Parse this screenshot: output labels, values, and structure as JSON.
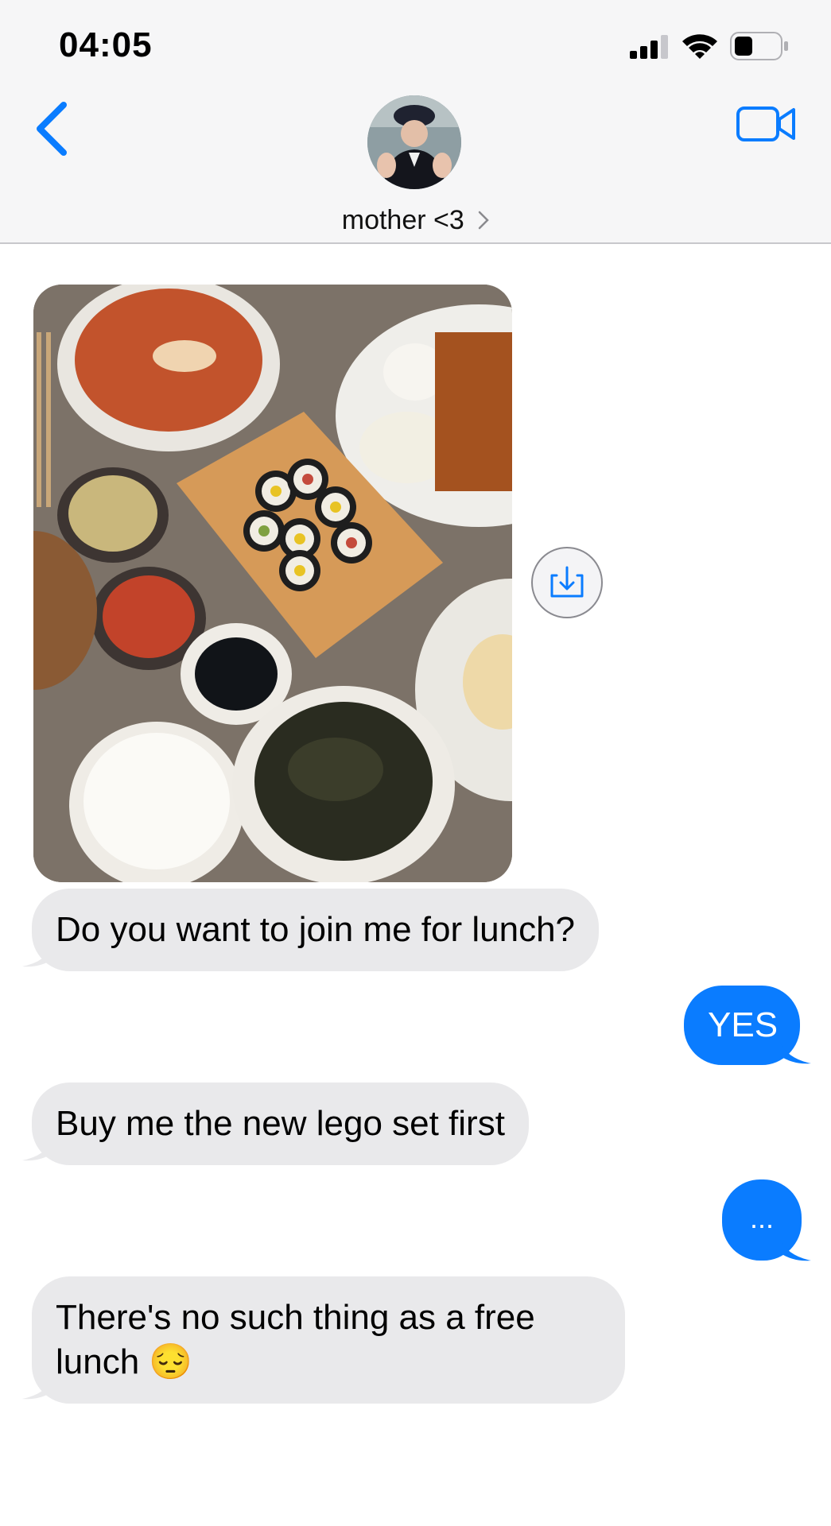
{
  "status_bar": {
    "time": "04:05"
  },
  "header": {
    "contact_name": "mother <3"
  },
  "messages": [
    {
      "from": "them",
      "text": "Do you want to join me for lunch?"
    },
    {
      "from": "me",
      "text": "YES"
    },
    {
      "from": "them",
      "text": "Buy me the new lego set first"
    },
    {
      "from": "me",
      "text": "..."
    },
    {
      "from": "them",
      "text_line1": "There's no such thing as a free",
      "text_line2": "lunch",
      "emoji": "😔"
    }
  ],
  "colors": {
    "accent": "#0a7cff",
    "incoming_bubble": "#e9e9eb",
    "header_bg": "#f6f6f7"
  },
  "icons": [
    "back-chevron-icon",
    "video-camera-icon",
    "save-download-icon",
    "signal-icon",
    "wifi-icon",
    "battery-icon"
  ]
}
